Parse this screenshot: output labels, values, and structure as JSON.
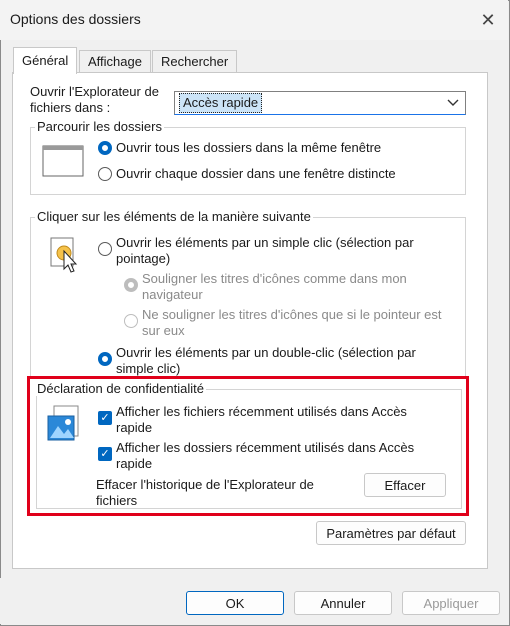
{
  "window": {
    "title": "Options des dossiers"
  },
  "tabs": [
    {
      "label": "Général"
    },
    {
      "label": "Affichage"
    },
    {
      "label": "Rechercher"
    }
  ],
  "open_explorer": {
    "label_line1": "Ouvrir l'Explorateur de",
    "label_line2": "fichiers dans :",
    "selected": "Accès rapide"
  },
  "browse_folders": {
    "title": "Parcourir les dossiers",
    "option1": "Ouvrir tous les dossiers dans la même fenêtre",
    "option2": "Ouvrir chaque dossier dans une fenêtre distincte"
  },
  "click_items": {
    "title": "Cliquer sur les éléments de la manière suivante",
    "single_line1": "Ouvrir les éléments par un simple clic (sélection par",
    "single_line2": "pointage)",
    "underline_all_line1": "Souligner les titres d'icônes comme dans mon",
    "underline_all_line2": "navigateur",
    "underline_hover_line1": "Ne souligner les titres d'icônes que si le pointeur est",
    "underline_hover_line2": "sur eux",
    "double_line1": "Ouvrir les éléments par un double-clic (sélection par",
    "double_line2": "simple clic)"
  },
  "privacy": {
    "title": "Déclaration de confidentialité",
    "recent_files_line1": "Afficher les fichiers récemment utilisés dans Accès",
    "recent_files_line2": "rapide",
    "recent_folders_line1": "Afficher les dossiers récemment utilisés dans Accès",
    "recent_folders_line2": "rapide",
    "clear_line1": "Effacer l'historique de l'Explorateur de",
    "clear_line2": "fichiers",
    "clear_button": "Effacer"
  },
  "defaults_button": "Paramètres par défaut",
  "footer": {
    "ok": "OK",
    "cancel": "Annuler",
    "apply": "Appliquer"
  },
  "colors": {
    "accent": "#0067c0",
    "highlight": "#e0001a"
  }
}
